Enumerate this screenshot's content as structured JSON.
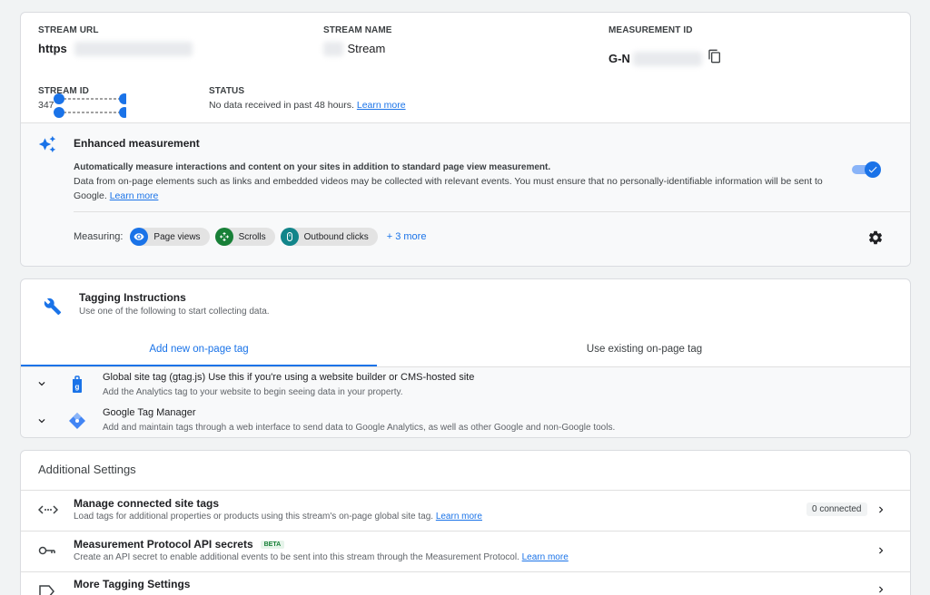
{
  "stream": {
    "url_label": "STREAM URL",
    "url_value": "https",
    "name_label": "STREAM NAME",
    "name_value": "Stream",
    "mid_label": "MEASUREMENT ID",
    "mid_value": "G-N",
    "id_label": "STREAM ID",
    "id_value": "347",
    "status_label": "STATUS",
    "status_text": "No data received in past 48 hours.",
    "status_link": "Learn more"
  },
  "enhanced": {
    "title": "Enhanced measurement",
    "line1": "Automatically measure interactions and content on your sites in addition to standard page view measurement.",
    "line2": "Data from on-page elements such as links and embedded videos may be collected with relevant events. You must ensure that no personally-identifiable information will be sent to Google.",
    "link": "Learn more",
    "measuring_label": "Measuring:",
    "chips": [
      "Page views",
      "Scrolls",
      "Outbound clicks"
    ],
    "more": "+ 3 more",
    "toggle_on": true
  },
  "tagging": {
    "title": "Tagging Instructions",
    "subtitle": "Use one of the following to start collecting data.",
    "tabs": [
      "Add new on-page tag",
      "Use existing on-page tag"
    ],
    "active_tab": 0,
    "options": [
      {
        "title": "Global site tag (gtag.js)",
        "title_rest": "Use this if you're using a website builder or CMS-hosted site",
        "desc": "Add the Analytics tag to your website to begin seeing data in your property."
      },
      {
        "title": "Google Tag Manager",
        "title_rest": "",
        "desc": "Add and maintain tags through a web interface to send data to Google Analytics, as well as other Google and non-Google tools."
      }
    ]
  },
  "additional": {
    "title": "Additional Settings",
    "rows": [
      {
        "title": "Manage connected site tags",
        "desc": "Load tags for additional properties or products using this stream's on-page global site tag.",
        "link": "Learn more",
        "badge": "0 connected",
        "beta": ""
      },
      {
        "title": "Measurement Protocol API secrets",
        "desc": "Create an API secret to enable additional events to be sent into this stream through the Measurement Protocol.",
        "link": "Learn more",
        "badge": "",
        "beta": "BETA"
      },
      {
        "title": "More Tagging Settings",
        "desc": "",
        "link": "",
        "badge": "",
        "beta": ""
      }
    ]
  },
  "colors": {
    "accent": "#1a73e8",
    "green": "#188038",
    "teal": "#12858a"
  }
}
